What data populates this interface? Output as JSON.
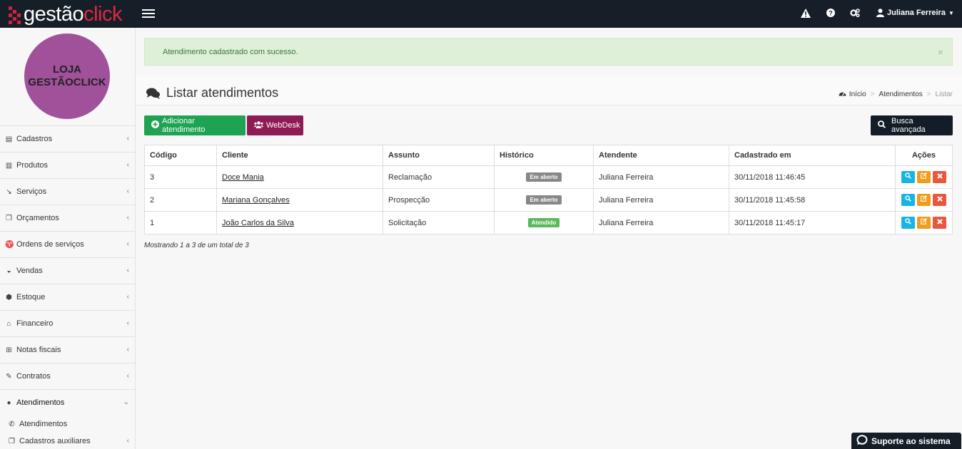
{
  "brand": {
    "part1": "gestão",
    "part2": "click"
  },
  "topbar": {
    "user_name": "Juliana Ferreira"
  },
  "avatar": {
    "line1": "LOJA",
    "line2": "GESTÃOCLICK"
  },
  "sidebar": {
    "items": [
      {
        "label": "Cadastros"
      },
      {
        "label": "Produtos"
      },
      {
        "label": "Serviços"
      },
      {
        "label": "Orçamentos"
      },
      {
        "label": "Ordens de serviços"
      },
      {
        "label": "Vendas"
      },
      {
        "label": "Estoque"
      },
      {
        "label": "Financeiro"
      },
      {
        "label": "Notas fiscais"
      },
      {
        "label": "Contratos"
      },
      {
        "label": "Atendimentos"
      }
    ],
    "submenu": [
      {
        "label": "Atendimentos"
      },
      {
        "label": "Cadastros auxiliares"
      }
    ]
  },
  "alert": {
    "message": "Atendimento cadastrado com sucesso.",
    "close": "×"
  },
  "header": {
    "title": "Listar atendimentos",
    "breadcrumb": {
      "home": "Início",
      "section": "Atendimentos",
      "current": "Listar"
    }
  },
  "toolbar": {
    "add_label": "Adicionar atendimento",
    "webdesk_label": "WebDesk",
    "search_label": "Busca avançada"
  },
  "table": {
    "headers": {
      "codigo": "Código",
      "cliente": "Cliente",
      "assunto": "Assunto",
      "historico": "Histórico",
      "atendente": "Atendente",
      "cadastrado": "Cadastrado em",
      "acoes": "Ações"
    },
    "rows": [
      {
        "codigo": "3",
        "cliente": "Doce Mania",
        "assunto": "Reclamação",
        "historico": "Em aberto",
        "atendente": "Juliana Ferreira",
        "cadastrado": "30/11/2018 11:46:45"
      },
      {
        "codigo": "2",
        "cliente": "Mariana Gonçalves",
        "assunto": "Prospecção",
        "historico": "Em aberto",
        "atendente": "Juliana Ferreira",
        "cadastrado": "30/11/2018 11:45:58"
      },
      {
        "codigo": "1",
        "cliente": "João Carlos da Silva",
        "assunto": "Solicitação",
        "historico": "Atendido",
        "atendente": "Juliana Ferreira",
        "cadastrado": "30/11/2018 11:45:17"
      }
    ]
  },
  "summary": "Mostrando 1 a 3 de um total de 3",
  "support": {
    "label": "Suporte ao sistema"
  },
  "colors": {
    "topbar": "#161f28",
    "accent_red": "#e0283f",
    "add_green": "#1ea352",
    "webdesk": "#8e1b54",
    "avatar": "#a0519a"
  }
}
